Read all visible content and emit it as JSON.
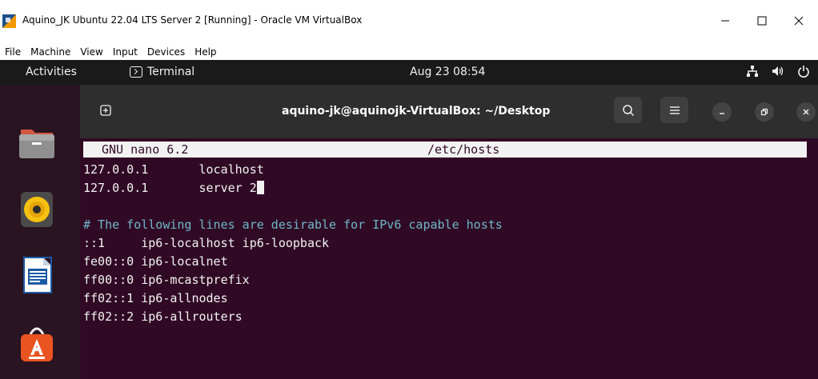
{
  "window": {
    "title": "Aquino_JK Ubuntu 22.04 LTS Server 2 [Running] - Oracle VM VirtualBox",
    "menu": [
      "File",
      "Machine",
      "View",
      "Input",
      "Devices",
      "Help"
    ]
  },
  "ubuntu": {
    "activities": "Activities",
    "app_name": "Terminal",
    "clock": "Aug 23  08:54"
  },
  "dock": {
    "items": [
      "files-icon",
      "rhythmbox-icon",
      "libreoffice-writer-icon",
      "ubuntu-software-icon"
    ]
  },
  "terminal": {
    "title": "aquino-jk@aquinojk-VirtualBox: ~/Desktop",
    "nano_version": "GNU nano 6.2",
    "nano_file": "/etc/hosts",
    "lines": [
      "127.0.0.1       localhost",
      "127.0.0.1       server 2",
      "",
      "# The following lines are desirable for IPv6 capable hosts",
      "::1     ip6-localhost ip6-loopback",
      "fe00::0 ip6-localnet",
      "ff00::0 ip6-mcastprefix",
      "ff02::1 ip6-allnodes",
      "ff02::2 ip6-allrouters"
    ]
  },
  "colors": {
    "terminal_bg": "#300a24",
    "header_bg": "#2e2e2e",
    "comment": "#6fb7c8",
    "text": "#f2f2f2"
  }
}
